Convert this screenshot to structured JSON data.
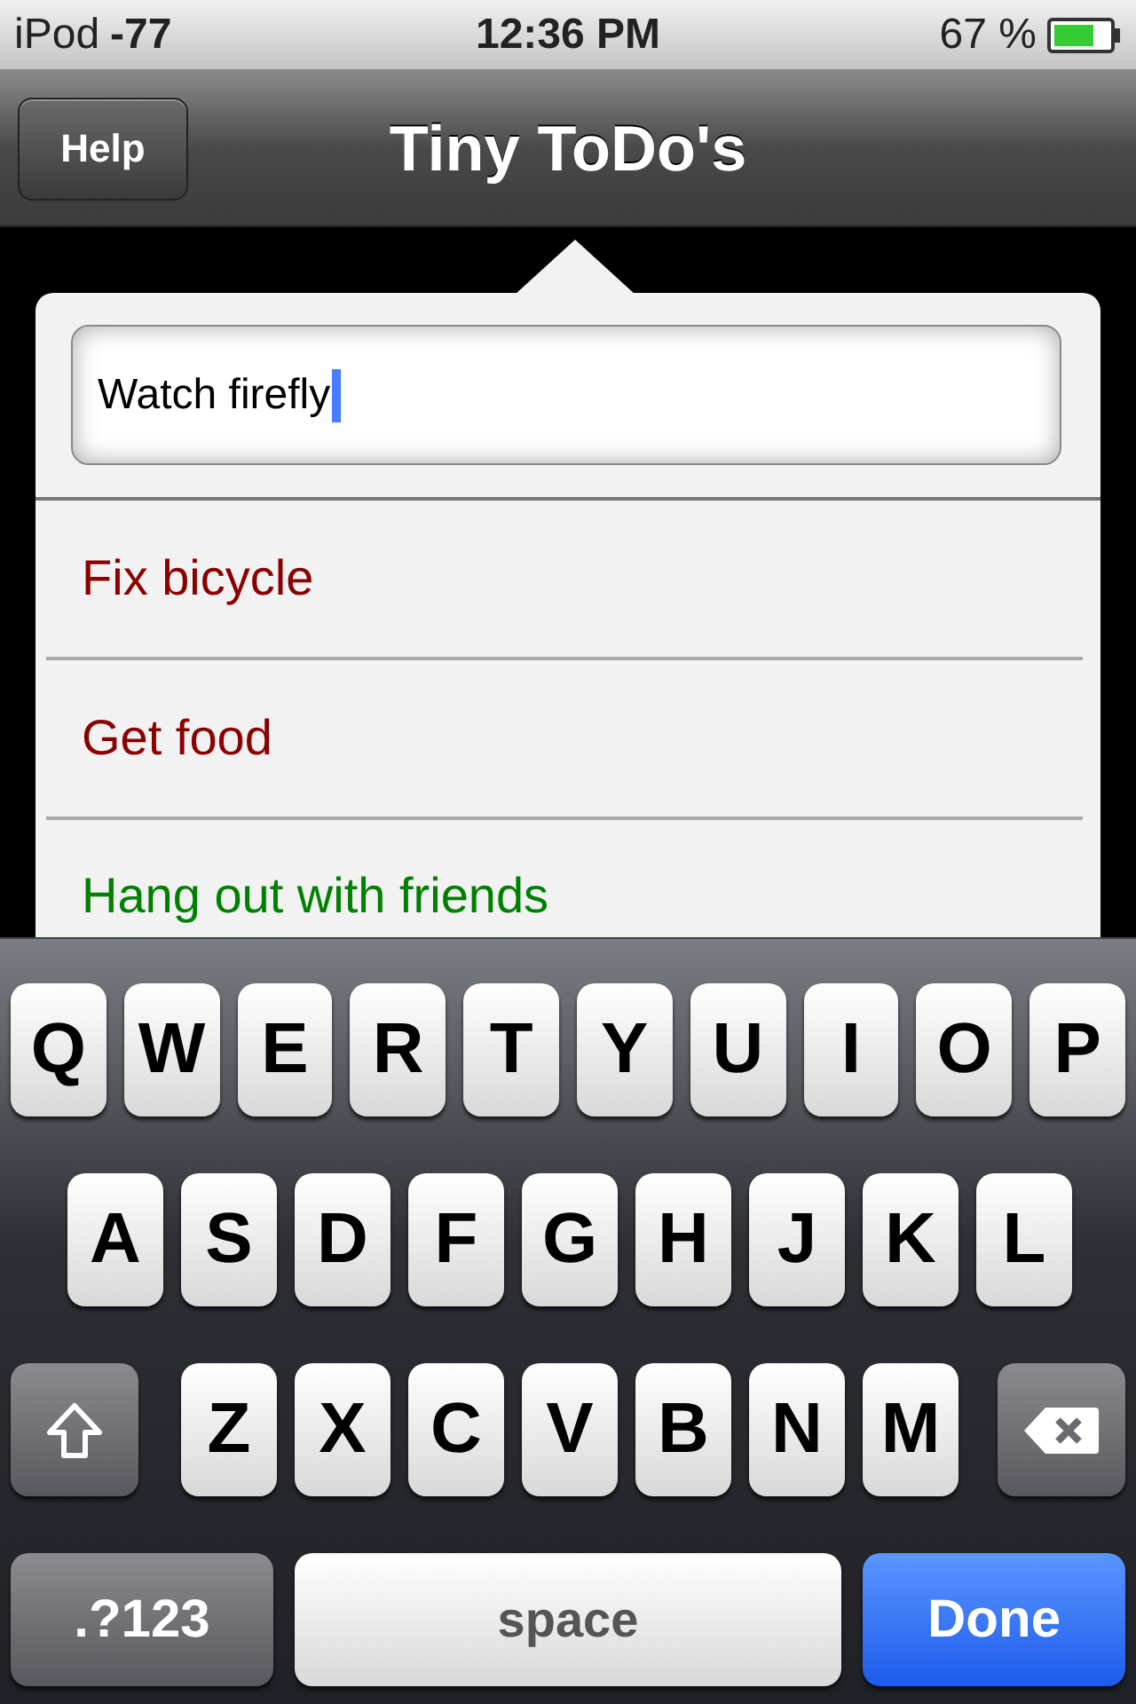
{
  "status_bar": {
    "carrier": "iPod",
    "signal": "-77",
    "time": "12:36 PM",
    "battery": "67 %"
  },
  "nav_bar": {
    "help_button": "Help",
    "title": "Tiny ToDo's"
  },
  "popover": {
    "input": {
      "value": "Watch firefly",
      "focused": true
    },
    "items": [
      {
        "text": "Fix bicycle",
        "color": "#8b0000"
      },
      {
        "text": "Get food",
        "color": "#8b0000"
      },
      {
        "text": "Hang out with friends",
        "color": "#008000"
      }
    ]
  },
  "keyboard": {
    "letter_rows": [
      [
        {
          "kind": "letter",
          "label": "Q"
        },
        {
          "kind": "letter",
          "label": "W"
        },
        {
          "kind": "letter",
          "label": "E"
        },
        {
          "kind": "letter",
          "label": "R"
        },
        {
          "kind": "letter",
          "label": "T"
        },
        {
          "kind": "letter",
          "label": "Y"
        },
        {
          "kind": "letter",
          "label": "U"
        },
        {
          "kind": "letter",
          "label": "I"
        },
        {
          "kind": "letter",
          "label": "O"
        },
        {
          "kind": "letter",
          "label": "P"
        }
      ],
      [
        {
          "kind": "letter",
          "label": "A"
        },
        {
          "kind": "letter",
          "label": "S"
        },
        {
          "kind": "letter",
          "label": "D"
        },
        {
          "kind": "letter",
          "label": "F"
        },
        {
          "kind": "letter",
          "label": "G"
        },
        {
          "kind": "letter",
          "label": "H"
        },
        {
          "kind": "letter",
          "label": "J"
        },
        {
          "kind": "letter",
          "label": "K"
        },
        {
          "kind": "letter",
          "label": "L"
        }
      ],
      [
        {
          "kind": "shift"
        },
        {
          "kind": "letter",
          "label": "Z"
        },
        {
          "kind": "letter",
          "label": "X"
        },
        {
          "kind": "letter",
          "label": "C"
        },
        {
          "kind": "letter",
          "label": "V"
        },
        {
          "kind": "letter",
          "label": "B"
        },
        {
          "kind": "letter",
          "label": "N"
        },
        {
          "kind": "letter",
          "label": "M"
        },
        {
          "kind": "backspace"
        }
      ]
    ],
    "bottom_keys": {
      "mode": ".?123",
      "space": "space",
      "done": "Done"
    }
  }
}
